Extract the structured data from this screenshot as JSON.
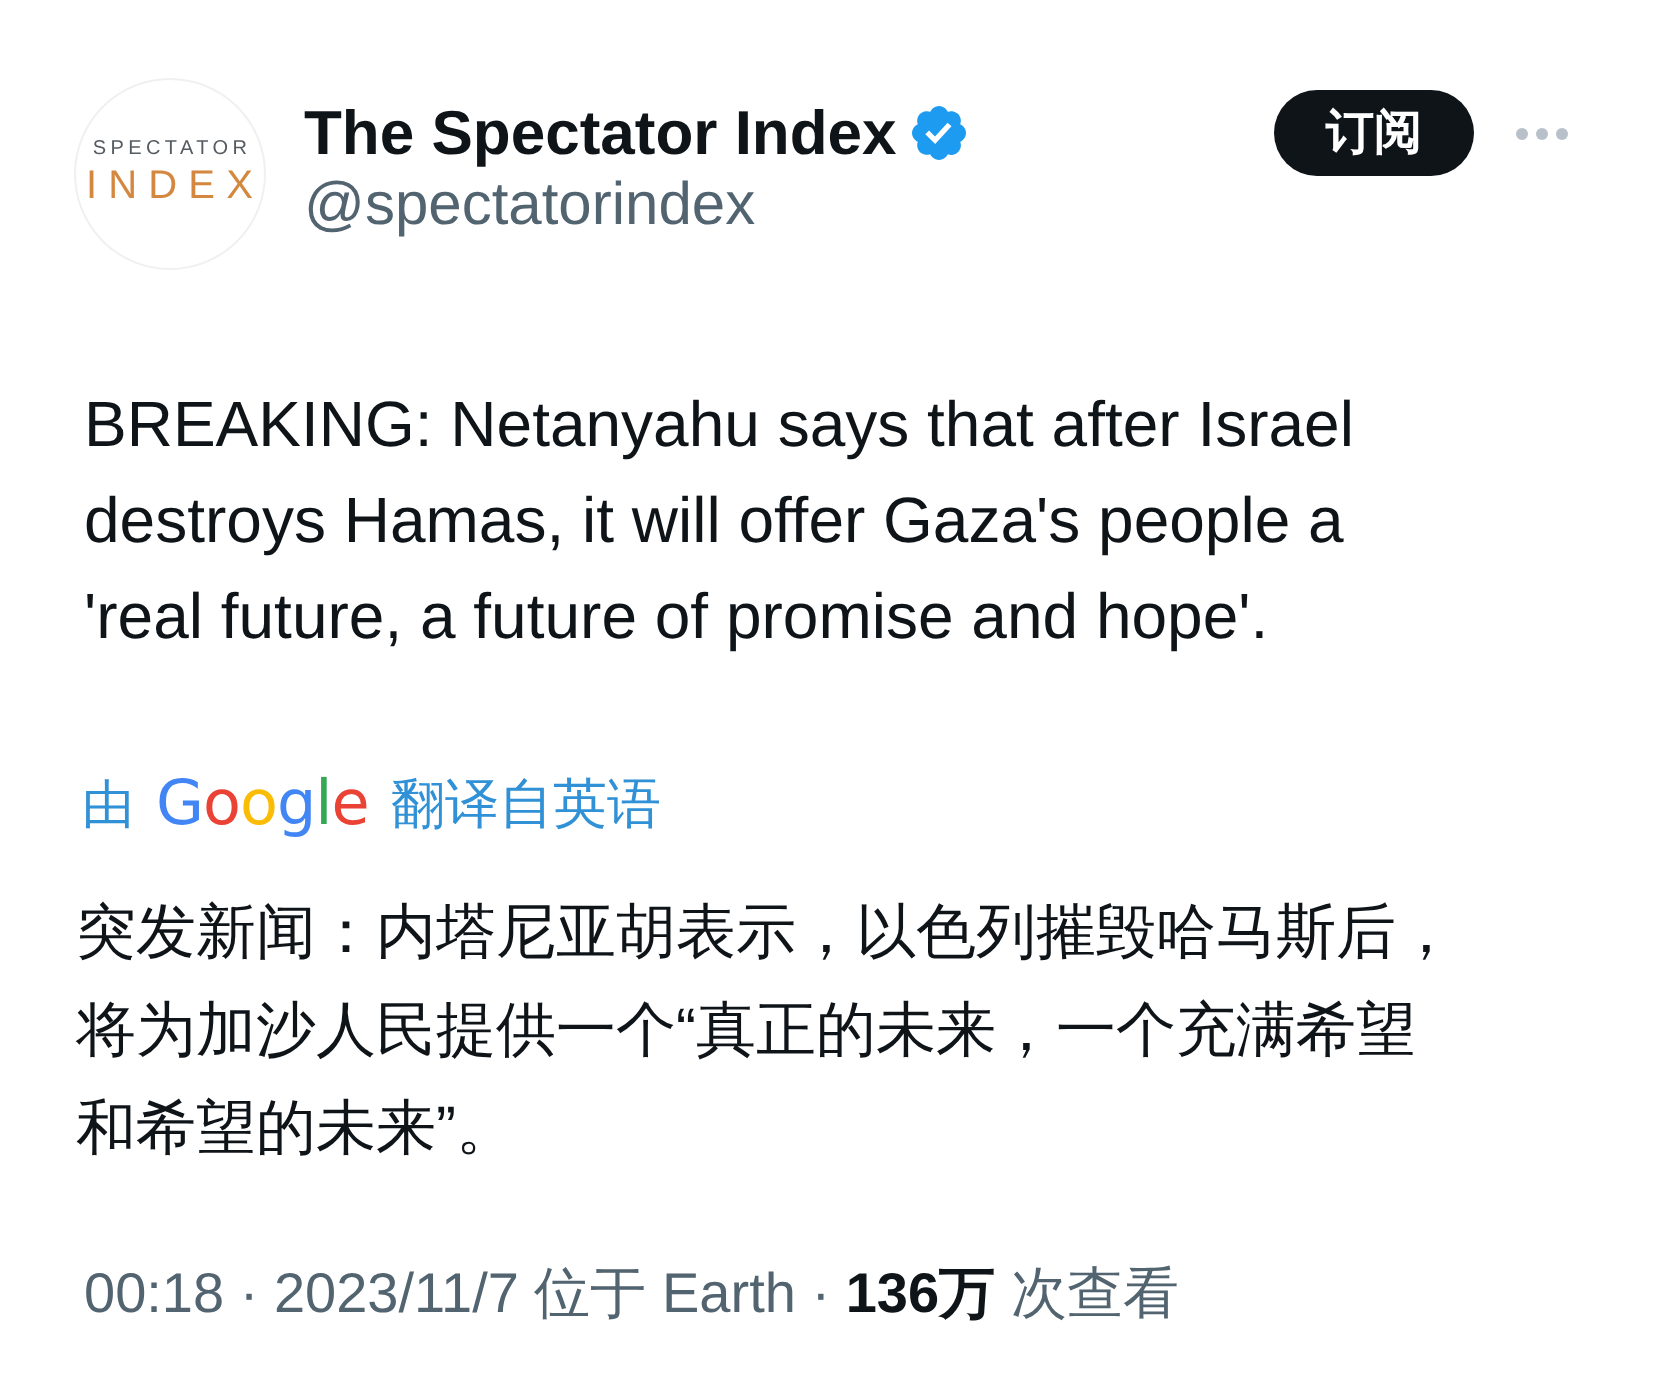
{
  "author": {
    "avatar": {
      "line_1": "SPECTATOR",
      "line_2": "INDEX"
    },
    "name": "The Spectator Index",
    "verified": true,
    "handle": "@spectatorindex"
  },
  "actions": {
    "subscribe_button": "订阅"
  },
  "tweet": {
    "text": "BREAKING: Netanyahu says that after Israel destroys Hamas, it will offer Gaza's people a 'real future, a future of promise and hope'.",
    "translation": {
      "prefix": "由",
      "provider": "Google",
      "label": "翻译自英语"
    },
    "translated_text": "突发新闻：内塔尼亚胡表示，以色列摧毁哈马斯后，将为加沙人民提供一个“真正的未来，一个充满希望和希望的未来”。",
    "meta": "00:18 · 2023/11/7 位于 Earth · **136万** 次查看"
  }
}
